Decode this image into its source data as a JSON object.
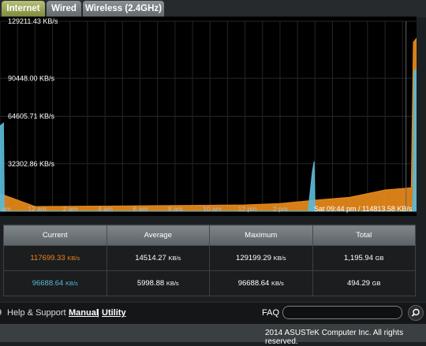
{
  "tabs": [
    {
      "label": "Internet",
      "active": true
    },
    {
      "label": "Wired",
      "active": false
    },
    {
      "label": "Wireless (2.4GHz)",
      "active": false
    }
  ],
  "chart_data": {
    "type": "area",
    "y_labels": [
      "129211.43 KB/s",
      "90448.00 KB/s",
      "64605.71 KB/s",
      "32302.86 KB/s"
    ],
    "y_label_values": [
      129211.43,
      90448.0,
      64605.71,
      32302.86
    ],
    "ylim": [
      0,
      129211.43
    ],
    "x_labels": [
      "am",
      "12 am",
      "2 am",
      "4 am",
      "6 am",
      "8 am",
      "10 am",
      "12 pm",
      "2 pm"
    ],
    "x_label_hours": [
      -2,
      0,
      2,
      4,
      6,
      8,
      10,
      12,
      14
    ],
    "xlim_hours": [
      -2,
      21.8
    ],
    "hover_label": "Sat 09:44 pm / 114813.58 KB/s",
    "series": [
      {
        "color": "#e88a1a",
        "points": [
          [
            -2,
            12000
          ],
          [
            0,
            3200
          ],
          [
            4,
            3500
          ],
          [
            8,
            3900
          ],
          [
            12,
            4300
          ],
          [
            14,
            5200
          ],
          [
            16,
            7500
          ],
          [
            18,
            9500
          ],
          [
            20,
            14500
          ],
          [
            21.5,
            16000
          ],
          [
            21.62,
            115000
          ],
          [
            21.8,
            117699
          ]
        ]
      },
      {
        "color": "#5ab8d6",
        "points": [
          [
            -2,
            58000
          ],
          [
            -1.8,
            60000
          ],
          [
            -1.75,
            0
          ],
          [
            15.6,
            0
          ],
          [
            15.85,
            27000
          ],
          [
            15.95,
            34000
          ],
          [
            16.0,
            0
          ],
          [
            21.55,
            0
          ],
          [
            21.6,
            10000
          ],
          [
            21.65,
            95000
          ],
          [
            21.8,
            96688
          ]
        ]
      }
    ]
  },
  "stats": {
    "headers": [
      "Current",
      "Average",
      "Maximum",
      "Total"
    ],
    "rows": [
      {
        "current": "117699.33",
        "current_unit": "KB/s",
        "current_color": "#f0851a",
        "average": "14514.27",
        "average_unit": "KB/s",
        "maximum": "129199.29",
        "maximum_unit": "KB/s",
        "total": "1,195.94",
        "total_unit": "GB"
      },
      {
        "current": "96688.64",
        "current_unit": "KB/s",
        "current_color": "#5ab8d6",
        "average": "5998.88",
        "average_unit": "KB/s",
        "maximum": "96688.64",
        "maximum_unit": "KB/s",
        "total": "494.29",
        "total_unit": "GB"
      }
    ]
  },
  "footer": {
    "help": "Help & Support",
    "manual": "Manual",
    "separator": "|",
    "utility": "Utility",
    "faq": "FAQ",
    "search_icon": "search-icon",
    "help_icon": "question-circle-icon"
  },
  "copyright": "2014 ASUSTeK Computer Inc. All rights reserved."
}
